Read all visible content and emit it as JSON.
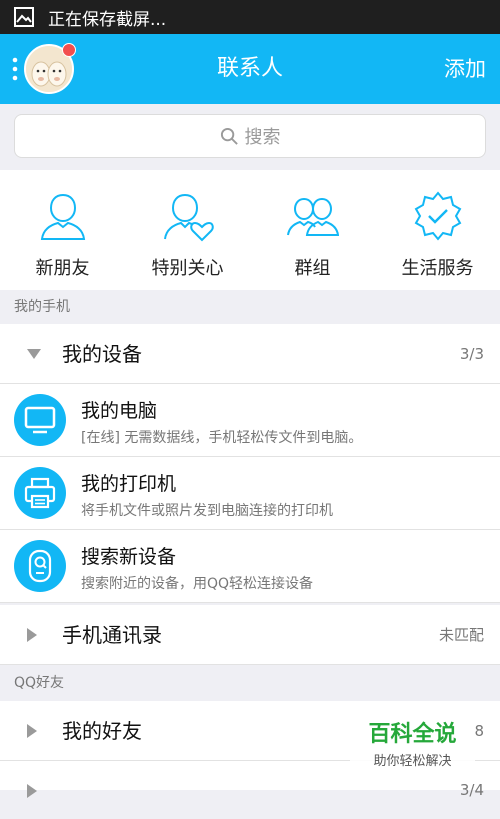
{
  "status_bar": {
    "icon": "image-icon",
    "text": "正在保存截屏..."
  },
  "header": {
    "title": "联系人",
    "add_label": "添加",
    "accent": "#12b7f5",
    "badge_color": "#f24e4e"
  },
  "search": {
    "placeholder": "搜索"
  },
  "quick_actions": [
    {
      "label": "新朋友",
      "icon": "person-icon"
    },
    {
      "label": "特别关心",
      "icon": "person-heart-icon"
    },
    {
      "label": "群组",
      "icon": "group-icon"
    },
    {
      "label": "生活服务",
      "icon": "badge-check-icon"
    }
  ],
  "sections": {
    "my_phone": "我的手机",
    "qq_friends": "QQ好友"
  },
  "my_devices": {
    "name": "我的设备",
    "count": "3/3"
  },
  "devices": [
    {
      "title": "我的电脑",
      "subtitle": "[在线] 无需数据线，手机轻松传文件到电脑。",
      "icon": "monitor-icon"
    },
    {
      "title": "我的打印机",
      "subtitle": "将手机文件或照片发到电脑连接的打印机",
      "icon": "printer-icon"
    },
    {
      "title": "搜索新设备",
      "subtitle": "搜索附近的设备，用QQ轻松连接设备",
      "icon": "device-search-icon"
    }
  ],
  "contacts_group": {
    "name": "手机通讯录",
    "status": "未匹配"
  },
  "friends_group": {
    "name": "我的好友",
    "count": "8"
  },
  "next_group": {
    "count": "3/4"
  },
  "watermark": {
    "title": "百科全说",
    "subtitle": "助你轻松解决"
  }
}
